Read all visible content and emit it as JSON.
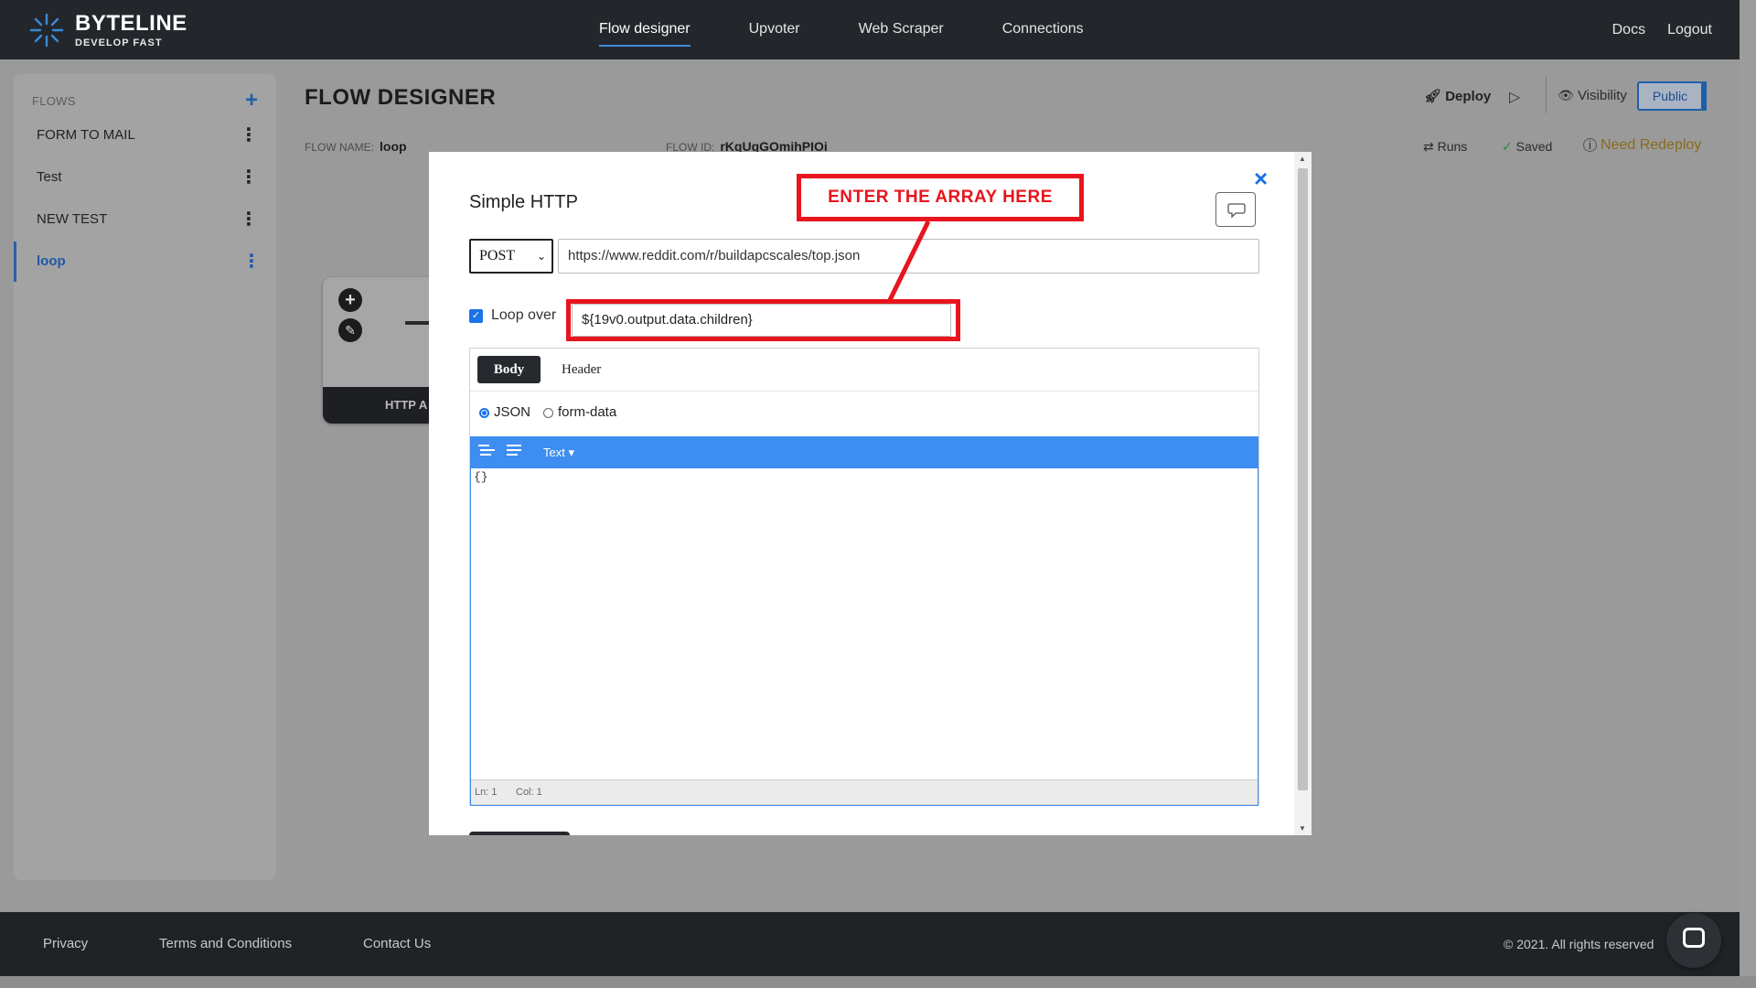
{
  "brand": {
    "name": "BYTELINE",
    "tagline": "DEVELOP FAST"
  },
  "nav": {
    "items": [
      "Flow designer",
      "Upvoter",
      "Web Scraper",
      "Connections"
    ],
    "right": [
      "Docs",
      "Logout"
    ]
  },
  "sidebar": {
    "title": "FLOWS",
    "add": "+",
    "items": [
      {
        "label": "FORM TO MAIL"
      },
      {
        "label": "Test"
      },
      {
        "label": "NEW TEST"
      },
      {
        "label": "loop",
        "active": true
      }
    ]
  },
  "header": {
    "title": "FLOW DESIGNER",
    "flow_name_label": "FLOW NAME:",
    "flow_name": "loop",
    "flow_id_label": "FLOW ID:",
    "flow_id": "rKqUgGOmihPIOi",
    "deploy": "Deploy",
    "visibility": "Visibility",
    "public": "Public",
    "runs": "Runs",
    "saved": "Saved",
    "need_redeploy": "Need Redeploy"
  },
  "canvas": {
    "node_label": "HTTP A"
  },
  "modal": {
    "title": "Simple HTTP",
    "close": "×",
    "method": "POST",
    "url": "https://www.reddit.com/r/buildapcscales/top.json",
    "loop_label": "Loop over",
    "loop_checked": true,
    "loop_value": "${19v0.output.data.children}",
    "annotation": "ENTER THE ARRAY HERE",
    "tabs": [
      "Body",
      "Header"
    ],
    "format_options": [
      "JSON",
      "form-data"
    ],
    "selected_format": "JSON",
    "editor_mode": "Text ▾",
    "editor_content": "{}",
    "status": {
      "line": "Ln: 1",
      "col": "Col: 1"
    }
  },
  "footer": {
    "links": [
      "Privacy",
      "Terms and Conditions",
      "Contact Us"
    ],
    "copyright": "© 2021. All rights reserved"
  },
  "colors": {
    "navbar": "#23272b",
    "accent": "#1a73e8",
    "annotation": "#e8141e",
    "editor_toolbar": "#3d8ef0",
    "warning": "#8a6a1e",
    "success": "#2b8a3e"
  }
}
